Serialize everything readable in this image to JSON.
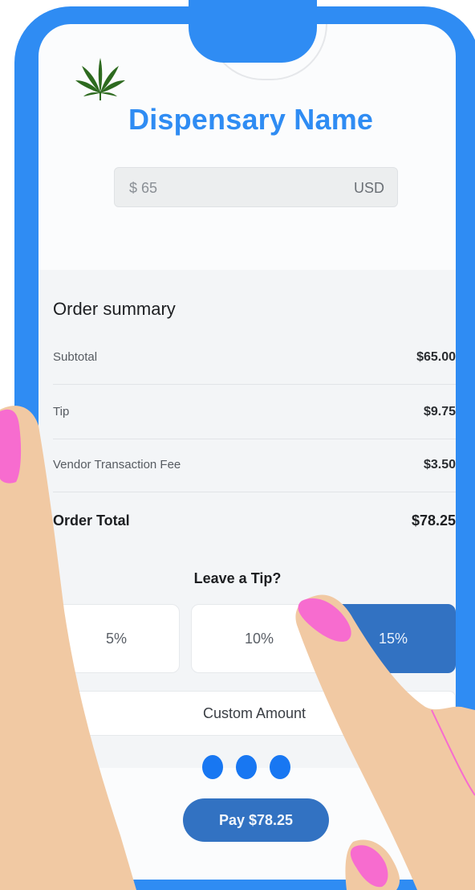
{
  "brand": {
    "name": "Dispensary Name",
    "logo_icon": "cannabis-leaf-icon"
  },
  "amount_field": {
    "value": "$ 65",
    "currency": "USD"
  },
  "order_summary": {
    "title": "Order summary",
    "rows": [
      {
        "label": "Subtotal",
        "value": "$65.00"
      },
      {
        "label": "Tip",
        "value": "$9.75"
      },
      {
        "label": "Vendor Transaction Fee",
        "value": "$3.50"
      }
    ],
    "total": {
      "label": "Order Total",
      "value": "$78.25"
    }
  },
  "tip": {
    "heading": "Leave a Tip?",
    "options": [
      "5%",
      "10%",
      "15%"
    ],
    "selected": "15%",
    "custom_label": "Custom Amount"
  },
  "pay_button": {
    "label": "Pay $78.25"
  },
  "colors": {
    "accent": "#2f8cf3",
    "button": "#3272c2",
    "leaf": "#2d6a1f",
    "nail": "#f76ccf",
    "skin": "#f1c9a3"
  }
}
